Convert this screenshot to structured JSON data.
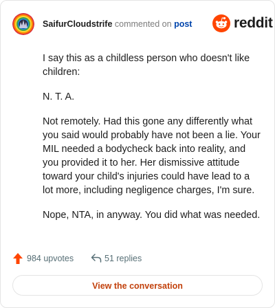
{
  "header": {
    "username": "SaifurCloudstrife",
    "action": "commented on",
    "post_link": "post",
    "brand_wordmark": "reddit",
    "brand_icon": "reddit-alien-icon",
    "avatar_icon": "rainbow-avatar-icon"
  },
  "comment": {
    "paragraphs": [
      "I say this as a childless person who doesn't like children:",
      "N. T. A.",
      "Not remotely. Had this gone any differently what you said would probably have not been a lie. Your MIL needed a bodycheck back into reality, and you provided it to her. Her dismissive attitude toward your child's injuries could have lead to a lot more, including negligence charges, I'm sure.",
      "Nope, NTA, in anyway. You did what was needed."
    ]
  },
  "footer": {
    "upvotes": "984 upvotes",
    "replies": "51 replies",
    "upvote_icon": "upvote-arrow-icon",
    "reply_icon": "reply-arrow-icon"
  },
  "cta": {
    "label": "View the conversation"
  },
  "colors": {
    "upvote": "#ff4500",
    "brand": "#ff4500",
    "link": "#0045ac",
    "cta_text": "#c2410c"
  }
}
